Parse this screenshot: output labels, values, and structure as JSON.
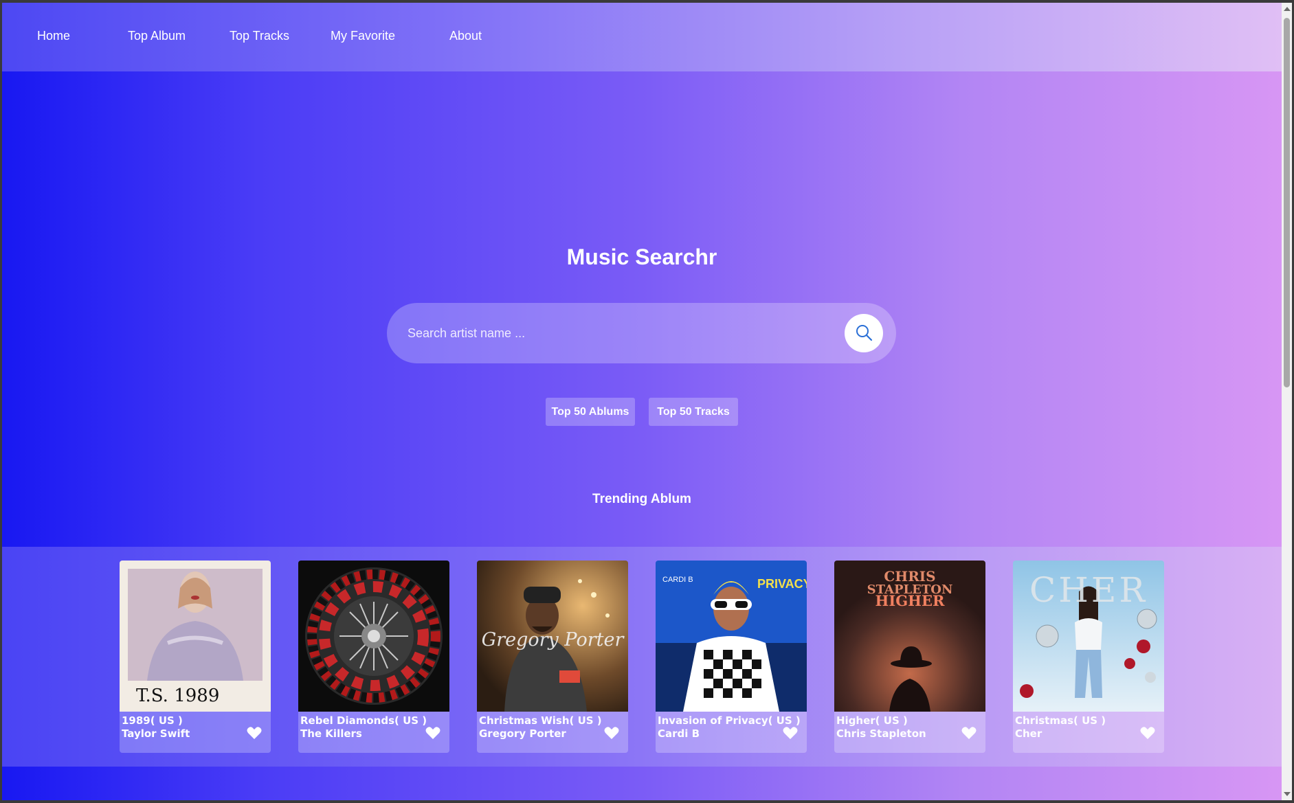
{
  "nav": {
    "items": [
      {
        "label": "Home"
      },
      {
        "label": "Top Album"
      },
      {
        "label": "Top Tracks"
      },
      {
        "label": "My Favorite"
      },
      {
        "label": "About"
      }
    ]
  },
  "hero": {
    "title": "Music Searchr",
    "search_placeholder": "Search artist name ...",
    "search_icon": "search-icon",
    "buttons": [
      {
        "label": "Top 50 Ablums"
      },
      {
        "label": "Top 50 Tracks"
      }
    ]
  },
  "trending": {
    "title": "Trending Ablum",
    "albums": [
      {
        "title": "1989( US )",
        "artist": "Taylor Swift",
        "cover_text": "T.S.   1989"
      },
      {
        "title": "Rebel Diamonds( US )",
        "artist": "The Killers",
        "cover_text": ""
      },
      {
        "title": "Christmas Wish( US )",
        "artist": "Gregory Porter",
        "cover_text": "Gregory Porter"
      },
      {
        "title": "Invasion of Privacy( US )",
        "artist": "Cardi B",
        "cover_text": "CARDI B"
      },
      {
        "title": "Higher( US )",
        "artist": "Chris Stapleton",
        "cover_text": "HIGHER"
      },
      {
        "title": "Christmas( US )",
        "artist": "Cher",
        "cover_text": "CHER"
      }
    ],
    "favorite_icon": "heart-icon"
  },
  "colors": {
    "gradient_start": "#1818f2",
    "gradient_end": "#d796f4",
    "accent": "#2a6fd6"
  }
}
